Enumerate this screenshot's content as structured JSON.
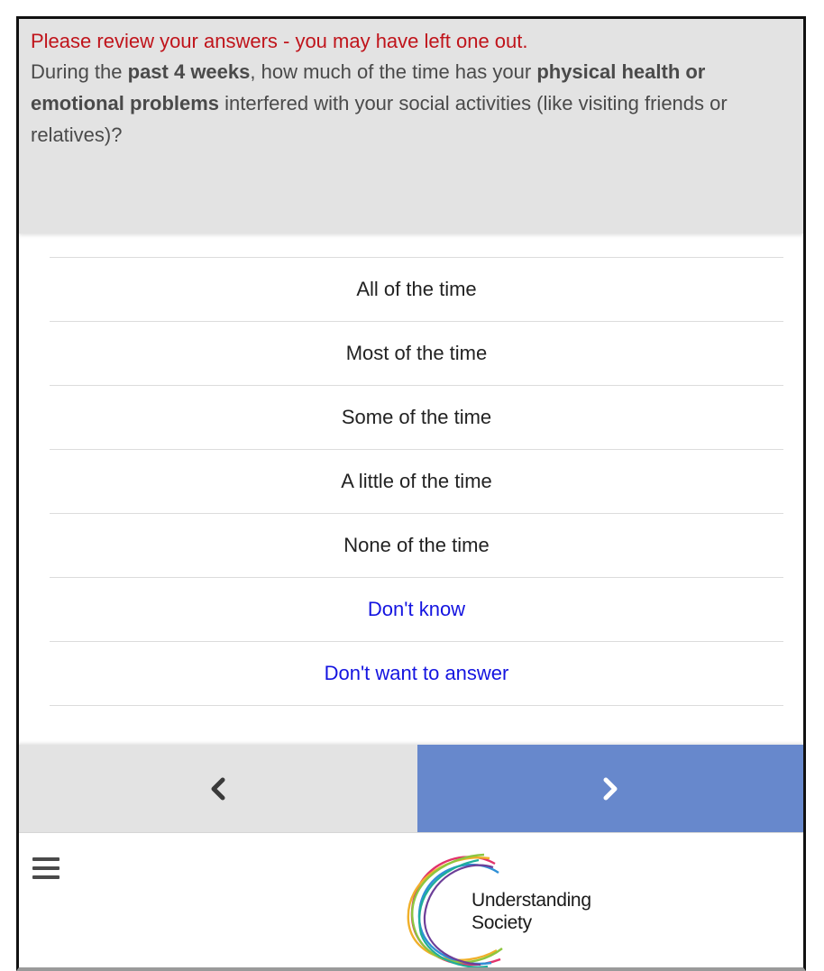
{
  "question": {
    "warning": "Please review your answers - you may have left one out.",
    "text_parts": [
      {
        "text": "During the ",
        "bold": false
      },
      {
        "text": "past 4 weeks",
        "bold": true
      },
      {
        "text": ", how much of the time has your ",
        "bold": false
      },
      {
        "text": "physical health or emotional problems",
        "bold": true
      },
      {
        "text": " interfered with your social activities (like visiting friends or relatives)?",
        "bold": false
      }
    ]
  },
  "options": [
    {
      "label": "All of the time",
      "special": false
    },
    {
      "label": "Most of the time",
      "special": false
    },
    {
      "label": "Some of the time",
      "special": false
    },
    {
      "label": "A little of the time",
      "special": false
    },
    {
      "label": "None of the time",
      "special": false
    },
    {
      "label": "Don't know",
      "special": true
    },
    {
      "label": "Don't want to answer",
      "special": true
    }
  ],
  "nav": {
    "prev_icon": "chevron-left-icon",
    "next_icon": "chevron-right-icon"
  },
  "footer": {
    "menu_icon": "hamburger-menu-icon",
    "logo": {
      "line1": "Understanding",
      "line2": "Society"
    }
  },
  "colors": {
    "warning": "#c0141b",
    "panel_bg": "#e3e3e3",
    "next_button": "#6788cc",
    "special_option": "#1414e0"
  }
}
